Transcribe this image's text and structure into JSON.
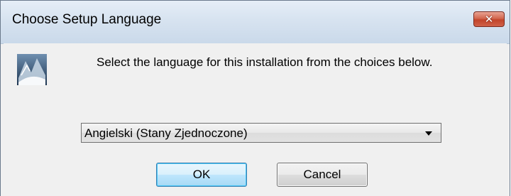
{
  "window": {
    "title": "Choose Setup Language",
    "close_symbol": "✕"
  },
  "icons": {
    "app": "setup-installer-icon",
    "close": "close-icon",
    "dropdown": "chevron-down-icon"
  },
  "dialog": {
    "prompt": "Select the language for this installation from the choices below."
  },
  "language_select": {
    "selected": "Angielski (Stany Zjednoczone)"
  },
  "buttons": {
    "ok": "OK",
    "cancel": "Cancel"
  },
  "colors": {
    "close_button": "#c2442b",
    "default_button_border": "#3c7fb1"
  }
}
